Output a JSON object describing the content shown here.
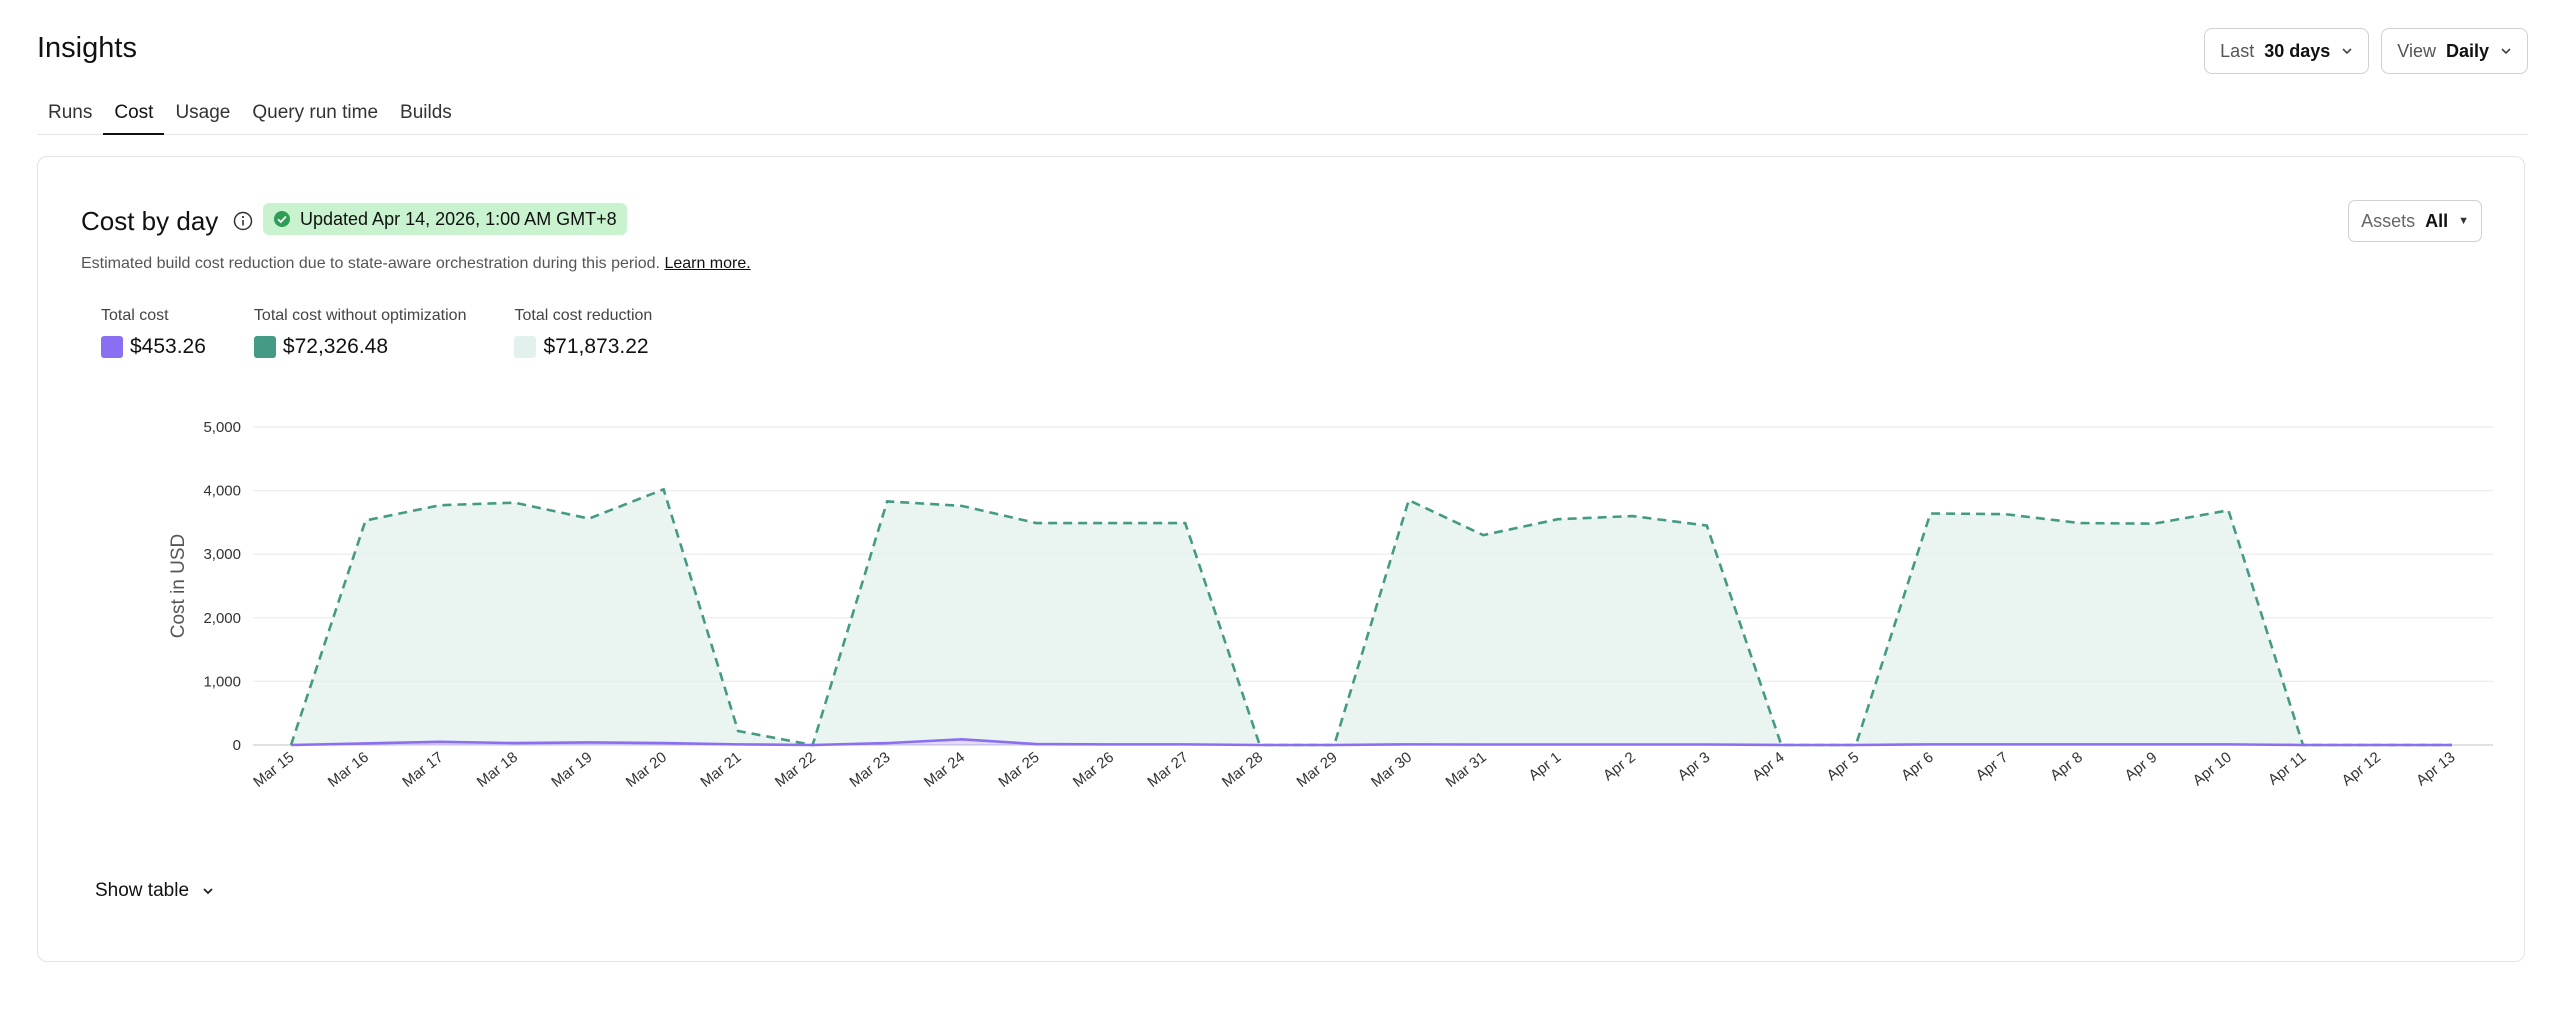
{
  "header": {
    "title": "Insights"
  },
  "controls": {
    "range": {
      "label": "Last",
      "value": "30 days"
    },
    "view": {
      "label": "View",
      "value": "Daily"
    }
  },
  "tabs": [
    {
      "label": "Runs",
      "active": false
    },
    {
      "label": "Cost",
      "active": true
    },
    {
      "label": "Usage",
      "active": false
    },
    {
      "label": "Query run time",
      "active": false
    },
    {
      "label": "Builds",
      "active": false
    }
  ],
  "card": {
    "title": "Cost by day",
    "updated_badge": "Updated Apr 14, 2026, 1:00 AM GMT+8",
    "assets": {
      "label": "Assets",
      "value": "All"
    },
    "description": "Estimated build cost reduction due to state-aware orchestration during this period.",
    "learn_more": "Learn more.",
    "show_table": "Show table"
  },
  "legend": [
    {
      "label": "Total cost",
      "value": "$453.26",
      "color": "#8b6ff2"
    },
    {
      "label": "Total cost without optimization",
      "value": "$72,326.48",
      "color": "#449a84"
    },
    {
      "label": "Total cost reduction",
      "value": "$71,873.22",
      "color": "#e3f1ee"
    }
  ],
  "chart_data": {
    "type": "area",
    "ylabel": "Cost in USD",
    "ylim": [
      0,
      5000
    ],
    "yticks": [
      0,
      1000,
      2000,
      3000,
      4000,
      5000
    ],
    "ytick_labels": [
      "0",
      "1,000",
      "2,000",
      "3,000",
      "4,000",
      "5,000"
    ],
    "grid": true,
    "categories": [
      "Mar 15",
      "Mar 16",
      "Mar 17",
      "Mar 18",
      "Mar 19",
      "Mar 20",
      "Mar 21",
      "Mar 22",
      "Mar 23",
      "Mar 24",
      "Mar 25",
      "Mar 26",
      "Mar 27",
      "Mar 28",
      "Mar 29",
      "Mar 30",
      "Mar 31",
      "Apr 1",
      "Apr 2",
      "Apr 3",
      "Apr 4",
      "Apr 5",
      "Apr 6",
      "Apr 7",
      "Apr 8",
      "Apr 9",
      "Apr 10",
      "Apr 11",
      "Apr 12",
      "Apr 13"
    ],
    "series": [
      {
        "name": "Total cost without optimization",
        "style": "dashed",
        "color": "#449a84",
        "values": [
          0,
          3530,
          3770,
          3810,
          3560,
          4020,
          220,
          0,
          3830,
          3760,
          3490,
          3490,
          3490,
          0,
          0,
          3850,
          3300,
          3550,
          3600,
          3450,
          0,
          0,
          3640,
          3630,
          3490,
          3480,
          3690,
          0,
          0,
          0
        ]
      },
      {
        "name": "Total cost",
        "style": "solid",
        "color": "#8b6ff2",
        "values": [
          0,
          25,
          50,
          30,
          40,
          30,
          10,
          0,
          30,
          90,
          15,
          10,
          10,
          0,
          0,
          10,
          8,
          8,
          8,
          8,
          0,
          0,
          10,
          10,
          10,
          10,
          10,
          0,
          0,
          0
        ]
      }
    ],
    "reduction_fill_color": "#e3f1ee"
  }
}
